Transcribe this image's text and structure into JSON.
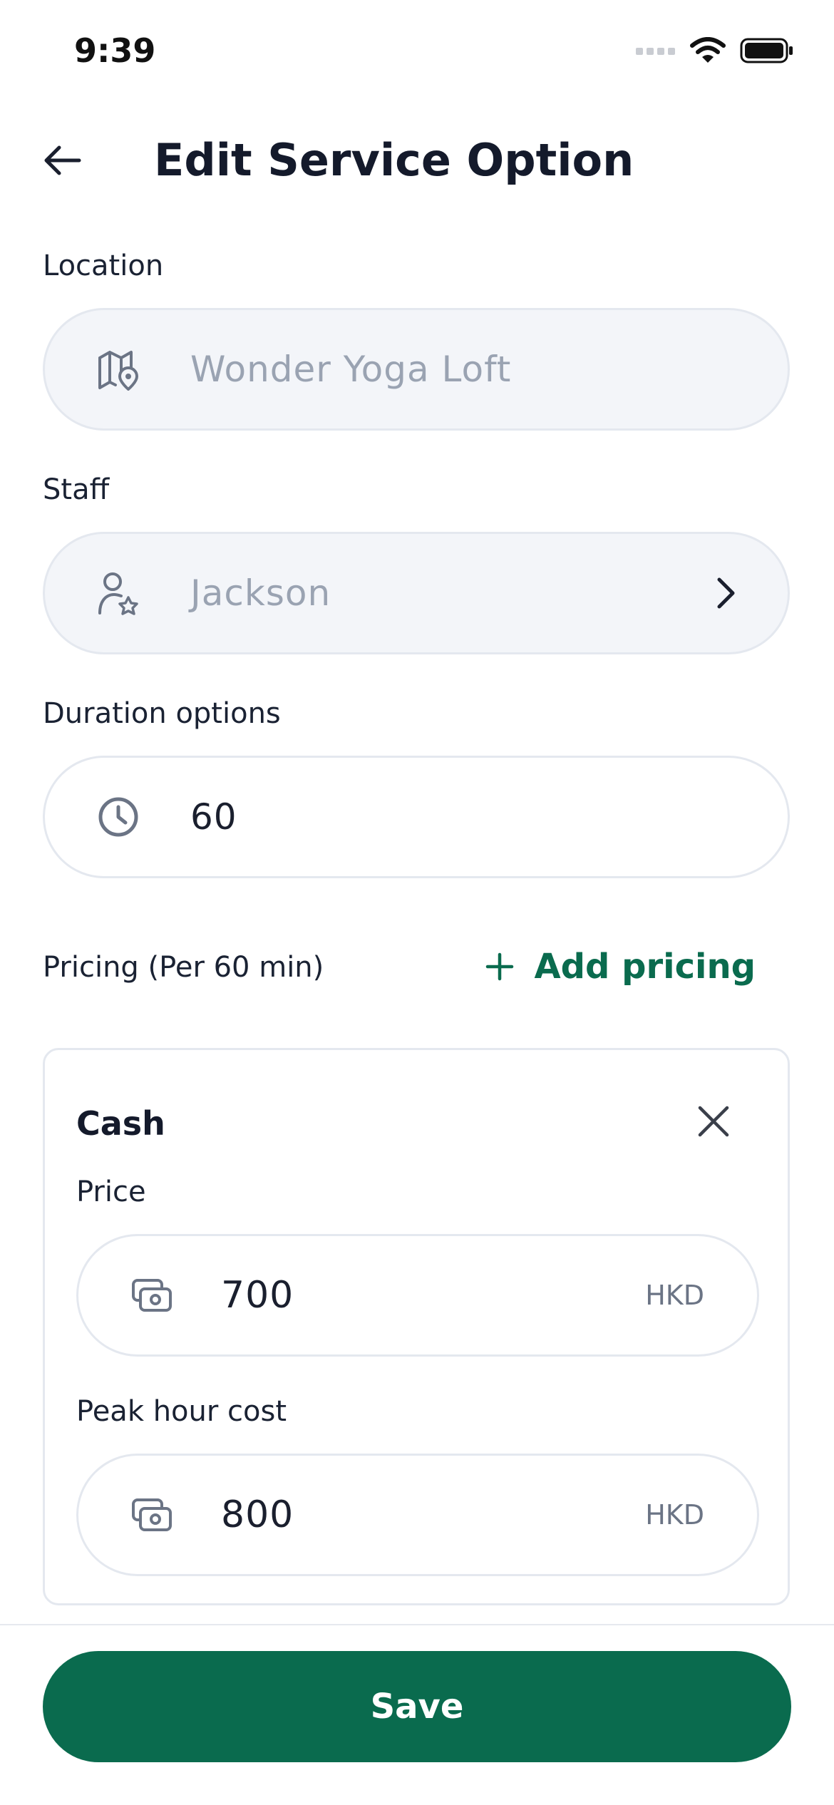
{
  "status_bar": {
    "time": "9:39"
  },
  "header": {
    "title": "Edit Service Option"
  },
  "location": {
    "label": "Location",
    "value": "Wonder Yoga Loft"
  },
  "staff": {
    "label": "Staff",
    "value": "Jackson"
  },
  "duration": {
    "label": "Duration options",
    "value": "60"
  },
  "pricing": {
    "label": "Pricing (Per 60 min)",
    "add_label": "Add pricing",
    "card": {
      "title": "Cash",
      "price_label": "Price",
      "price_value": "700",
      "price_currency": "HKD",
      "peak_label": "Peak hour cost",
      "peak_value": "800",
      "peak_currency": "HKD"
    }
  },
  "footer": {
    "save_label": "Save"
  },
  "colors": {
    "accent": "#0a6b4e",
    "border": "#e4e8ef",
    "disabled_bg": "#f3f5f9"
  }
}
